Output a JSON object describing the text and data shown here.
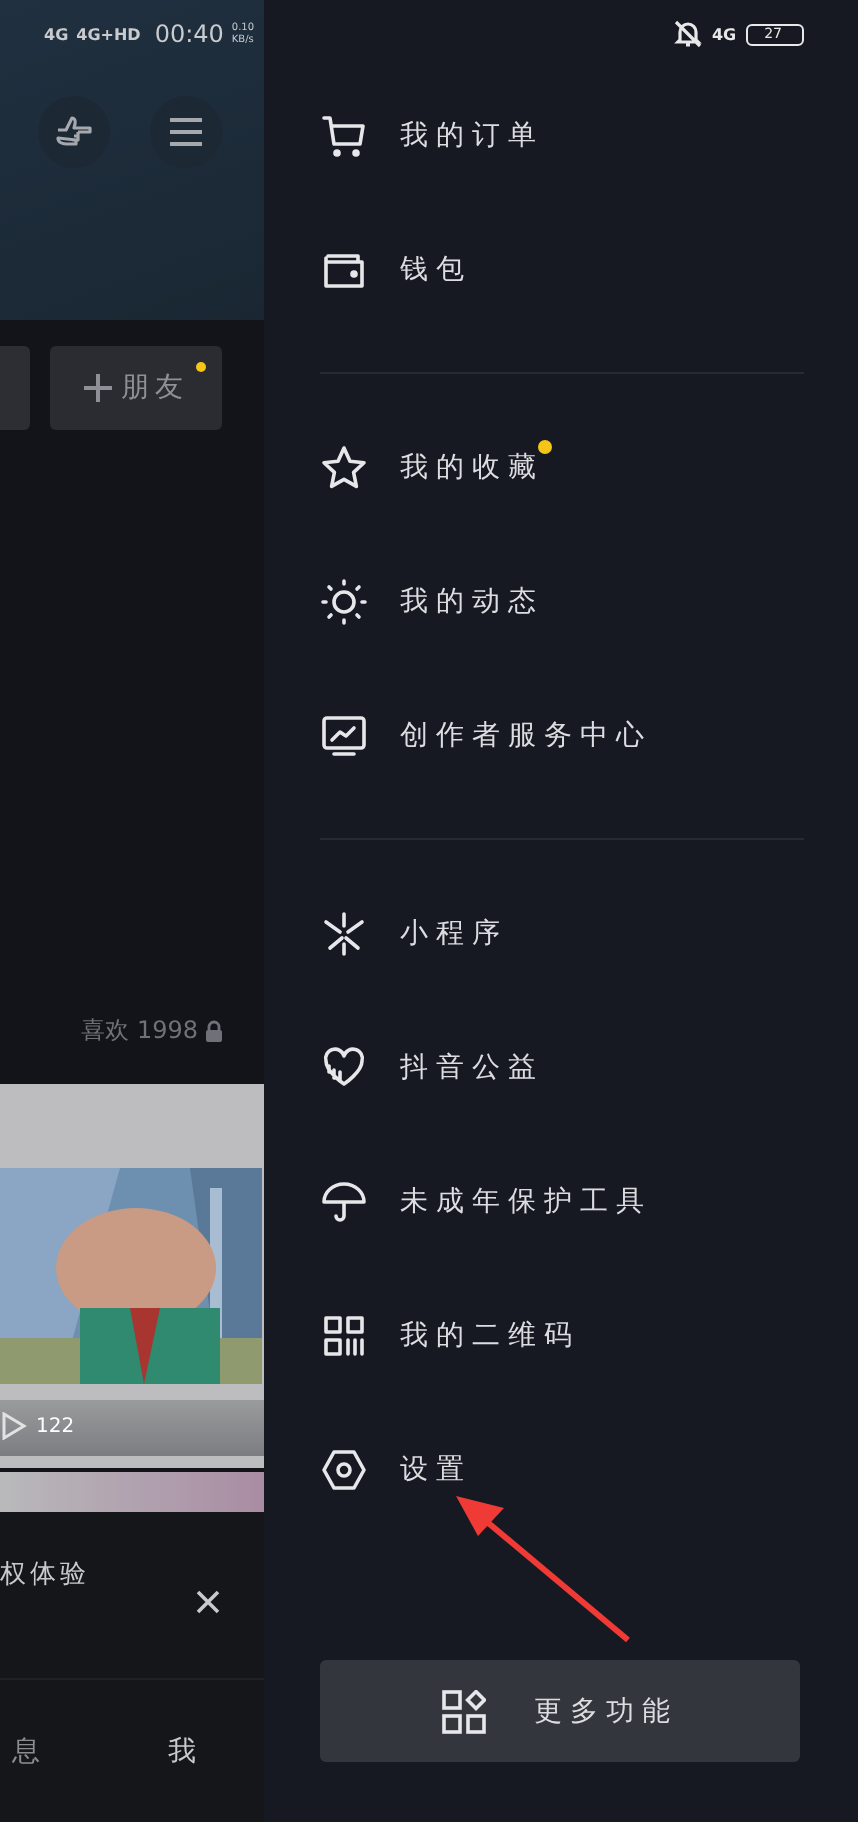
{
  "background_screen": {
    "status_bar": {
      "networks": [
        "4G",
        "4G+HD"
      ],
      "time": "00:40",
      "speed": "0.10",
      "speed_unit": "KB/s"
    },
    "add_friend_button": {
      "label": "朋友",
      "badge": true
    },
    "likes_label": "喜欢 1998",
    "video_card": {
      "kind": "picture",
      "views": "122"
    },
    "banner": {
      "text": "权体验"
    },
    "bottom_nav": [
      {
        "label": "息"
      },
      {
        "label": "我"
      }
    ]
  },
  "drawer": {
    "status_bar": {
      "network": "4G",
      "battery": "27"
    },
    "sections": [
      {
        "items": [
          {
            "label": "我的订单",
            "badge": false
          },
          {
            "label": "钱包",
            "badge": false
          }
        ]
      },
      {
        "items": [
          {
            "label": "我的收藏",
            "badge": true
          },
          {
            "label": "我的动态",
            "badge": false
          },
          {
            "label": "创作者服务中心",
            "badge": false
          }
        ]
      },
      {
        "items": [
          {
            "label": "小程序",
            "badge": false
          },
          {
            "label": "抖音公益",
            "badge": false
          },
          {
            "label": "未成年保护工具",
            "badge": false
          },
          {
            "label": "我的二维码",
            "badge": false
          },
          {
            "label": "设置",
            "badge": false
          }
        ]
      }
    ],
    "more_button": {
      "label": "更多功能"
    }
  }
}
